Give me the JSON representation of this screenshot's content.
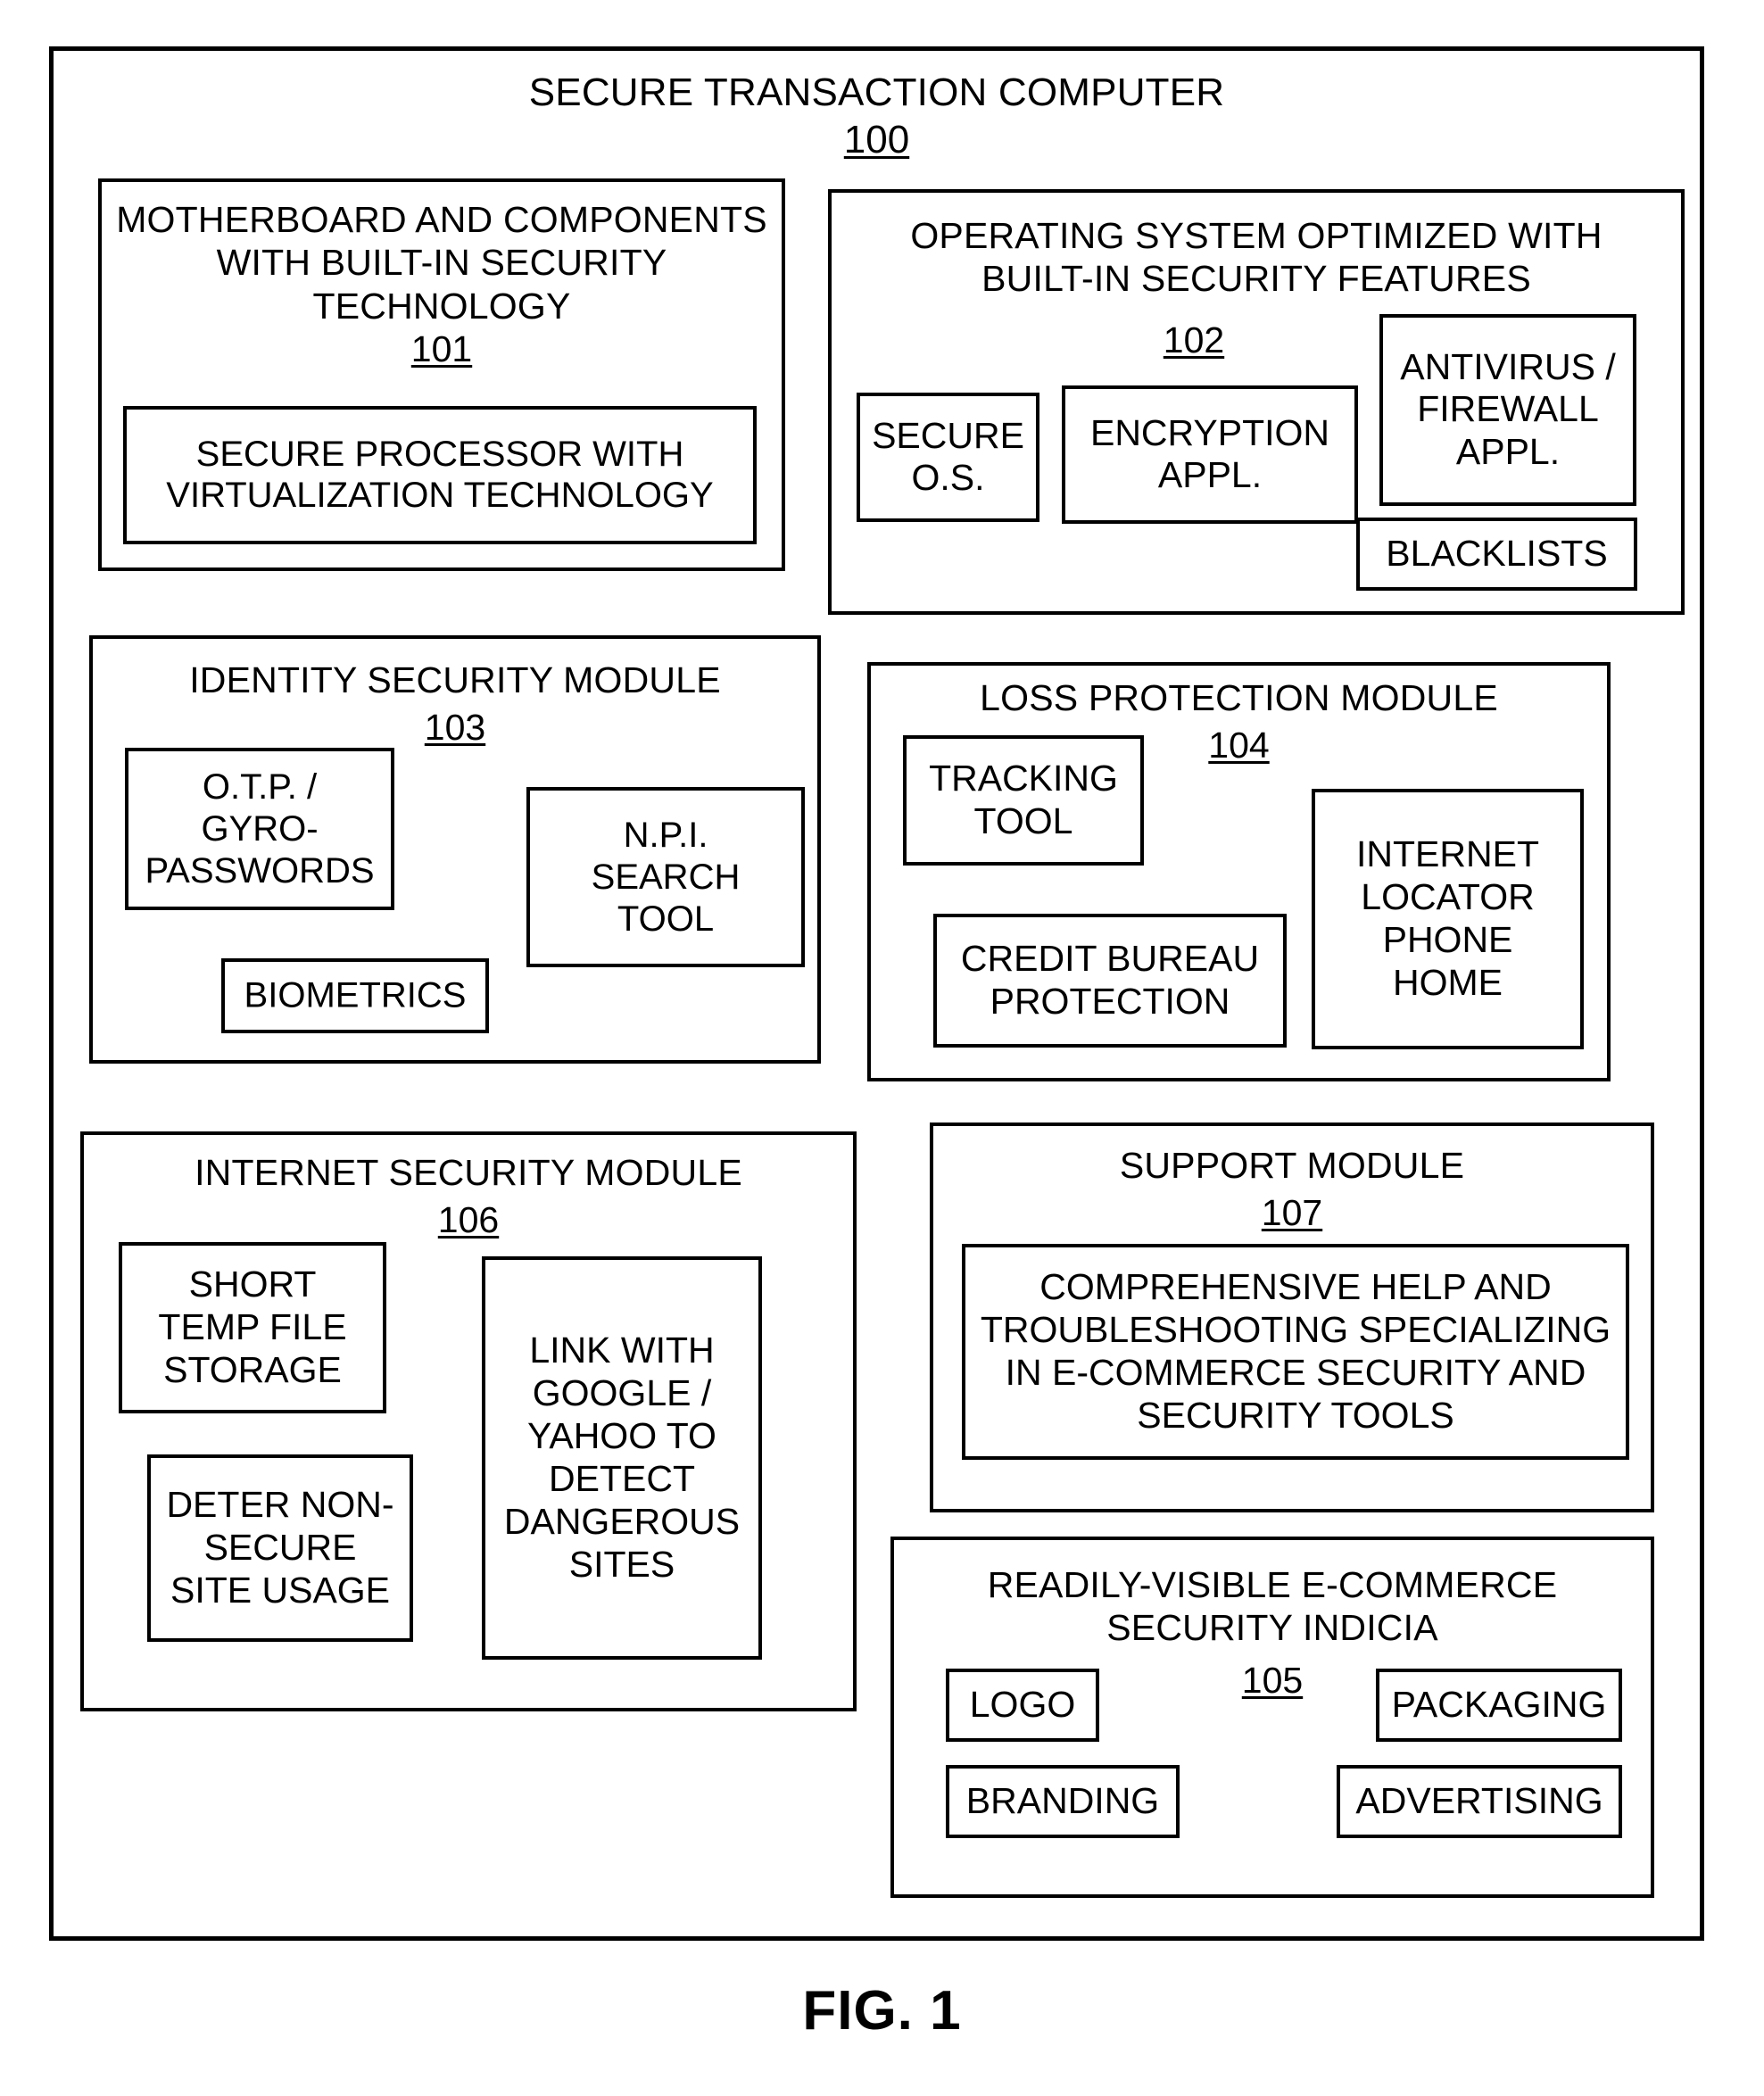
{
  "figure": {
    "caption": "FIG. 1"
  },
  "outer": {
    "title": "SECURE TRANSACTION COMPUTER",
    "ref": "100"
  },
  "modules": {
    "motherboard": {
      "title": "MOTHERBOARD AND COMPONENTS\nWITH BUILT-IN SECURITY\nTECHNOLOGY",
      "ref": "101",
      "children": [
        {
          "label": "SECURE PROCESSOR WITH\nVIRTUALIZATION TECHNOLOGY"
        }
      ]
    },
    "operating_system": {
      "title": "OPERATING SYSTEM OPTIMIZED WITH\nBUILT-IN SECURITY FEATURES",
      "ref": "102",
      "children": [
        {
          "label": "SECURE\nO.S."
        },
        {
          "label": "ENCRYPTION\nAPPL."
        },
        {
          "label": "ANTIVIRUS /\nFIREWALL\nAPPL."
        },
        {
          "label": "BLACKLISTS"
        }
      ]
    },
    "identity_security": {
      "title": "IDENTITY SECURITY MODULE",
      "ref": "103",
      "children": [
        {
          "label": "O.T.P. /\nGYRO-\nPASSWORDS"
        },
        {
          "label": "N.P.I.\nSEARCH\nTOOL"
        },
        {
          "label": "BIOMETRICS"
        }
      ]
    },
    "loss_protection": {
      "title": "LOSS PROTECTION MODULE",
      "ref": "104",
      "children": [
        {
          "label": "TRACKING\nTOOL"
        },
        {
          "label": "CREDIT BUREAU\nPROTECTION"
        },
        {
          "label": "INTERNET\nLOCATOR\nPHONE\nHOME"
        }
      ]
    },
    "internet_security": {
      "title": "INTERNET SECURITY MODULE",
      "ref": "106",
      "children": [
        {
          "label": "SHORT\nTEMP FILE\nSTORAGE"
        },
        {
          "label": "DETER NON-\nSECURE\nSITE USAGE"
        },
        {
          "label": "LINK WITH\nGOOGLE /\nYAHOO TO\nDETECT\nDANGEROUS\nSITES"
        }
      ]
    },
    "support": {
      "title": "SUPPORT MODULE",
      "ref": "107",
      "children": [
        {
          "label": "COMPREHENSIVE HELP AND\nTROUBLESHOOTING SPECIALIZING\nIN E-COMMERCE SECURITY AND\nSECURITY TOOLS"
        }
      ]
    },
    "security_indicia": {
      "title": "READILY-VISIBLE E-COMMERCE\nSECURITY INDICIA",
      "ref": "105",
      "children": [
        {
          "label": "LOGO"
        },
        {
          "label": "PACKAGING"
        },
        {
          "label": "BRANDING"
        },
        {
          "label": "ADVERTISING"
        }
      ]
    }
  }
}
